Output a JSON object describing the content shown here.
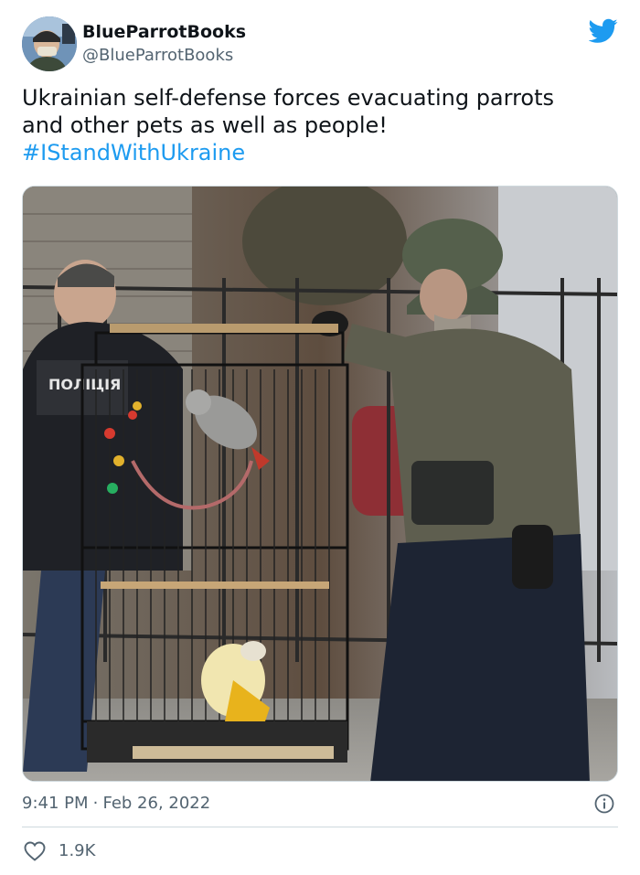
{
  "author": {
    "display_name": "BlueParrotBooks",
    "handle": "@BlueParrotBooks",
    "avatar_icon": "avatar-photo"
  },
  "brand": {
    "icon": "twitter-bird-icon",
    "color": "#1d9bf0"
  },
  "tweet": {
    "text_line1": "Ukrainian self-defense forces evacuating parrots",
    "text_line2": "and other pets as well as people!",
    "hashtag": "#IStandWithUkraine",
    "hashtag_color": "#1d9bf0"
  },
  "media": {
    "type": "photo",
    "sign_text": "ПОЛІЦІЯ"
  },
  "meta": {
    "time": "9:41 PM",
    "separator": "·",
    "date": "Feb 26, 2022",
    "info_icon": "info-icon"
  },
  "engagement": {
    "like_icon": "heart-icon",
    "likes": "1.9K"
  }
}
